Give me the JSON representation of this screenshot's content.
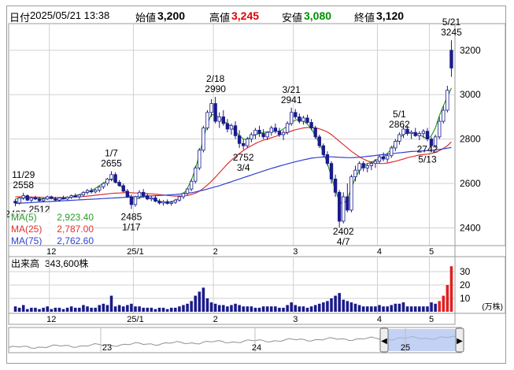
{
  "header": {
    "date_label": "日付",
    "date": "2025/05/21 13:38",
    "open_label": "始値",
    "open": "3,200",
    "high_label": "高値",
    "high": "3,245",
    "low_label": "安値",
    "low": "3,080",
    "close_label": "終値",
    "close": "3,120"
  },
  "colors": {
    "up": "#1a1a8c",
    "up_fill": "#ffffff",
    "down": "#1a1a8c",
    "ma5": "#2a9a2a",
    "ma25": "#e03030",
    "ma75": "#3040d0",
    "volume": "#1a1a8c",
    "volume_recent": "#e02020",
    "high_text": "#e00000",
    "low_text": "#009000",
    "grid": "#d0d0d0",
    "navigator_fill": "#a9bdf0"
  },
  "legend": [
    {
      "name": "MA(5)",
      "value": "2,923.40"
    },
    {
      "name": "MA(25)",
      "value": "2,787.00"
    },
    {
      "name": "MA(75)",
      "value": "2,762.60"
    }
  ],
  "volume_panel": {
    "label": "出来高",
    "value": "343,600株",
    "unit": "(万株)",
    "ticks": [
      "30",
      "20",
      "10"
    ]
  },
  "navigator": {
    "year_labels": [
      "23",
      "24",
      "25"
    ]
  },
  "chart_data": {
    "type": "candlestick",
    "price_axis": {
      "min": 2320,
      "max": 3320,
      "ticks": [
        2400,
        2600,
        2800,
        3000,
        3200
      ]
    },
    "x_axis_labels": [
      "12",
      "25/1",
      "2",
      "3",
      "4",
      "5"
    ],
    "annotations": [
      {
        "date": "11/29",
        "value": "2558"
      },
      {
        "date": "",
        "value": "2497"
      },
      {
        "date": "",
        "value": "2512"
      },
      {
        "date": "1/7",
        "value": "2655"
      },
      {
        "date": "1/17",
        "value": "2485"
      },
      {
        "date": "2/18",
        "value": "2990"
      },
      {
        "date": "3/4",
        "value": "2752"
      },
      {
        "date": "3/21",
        "value": "2941"
      },
      {
        "date": "4/7",
        "value": "2402"
      },
      {
        "date": "5/1",
        "value": "2862"
      },
      {
        "date": "5/13",
        "value": "2742"
      },
      {
        "date": "5/21",
        "value": "3245"
      }
    ],
    "candles": [
      [
        2520,
        2530,
        2497,
        2512
      ],
      [
        2512,
        2540,
        2505,
        2535
      ],
      [
        2535,
        2558,
        2525,
        2545
      ],
      [
        2545,
        2550,
        2520,
        2525
      ],
      [
        2525,
        2540,
        2515,
        2535
      ],
      [
        2535,
        2545,
        2525,
        2530
      ],
      [
        2530,
        2540,
        2518,
        2522
      ],
      [
        2522,
        2535,
        2515,
        2530
      ],
      [
        2530,
        2545,
        2525,
        2540
      ],
      [
        2540,
        2545,
        2528,
        2532
      ],
      [
        2532,
        2540,
        2520,
        2525
      ],
      [
        2525,
        2538,
        2518,
        2535
      ],
      [
        2535,
        2545,
        2528,
        2530
      ],
      [
        2530,
        2542,
        2522,
        2538
      ],
      [
        2538,
        2550,
        2530,
        2545
      ],
      [
        2545,
        2555,
        2535,
        2540
      ],
      [
        2540,
        2550,
        2530,
        2548
      ],
      [
        2548,
        2565,
        2540,
        2560
      ],
      [
        2560,
        2575,
        2550,
        2568
      ],
      [
        2568,
        2580,
        2555,
        2562
      ],
      [
        2562,
        2575,
        2555,
        2570
      ],
      [
        2570,
        2590,
        2560,
        2585
      ],
      [
        2585,
        2605,
        2575,
        2600
      ],
      [
        2600,
        2625,
        2590,
        2620
      ],
      [
        2620,
        2655,
        2610,
        2640
      ],
      [
        2640,
        2650,
        2600,
        2605
      ],
      [
        2605,
        2615,
        2585,
        2590
      ],
      [
        2590,
        2600,
        2560,
        2565
      ],
      [
        2565,
        2575,
        2535,
        2540
      ],
      [
        2540,
        2550,
        2485,
        2505
      ],
      [
        2505,
        2545,
        2495,
        2540
      ],
      [
        2540,
        2570,
        2530,
        2560
      ],
      [
        2560,
        2575,
        2535,
        2545
      ],
      [
        2545,
        2555,
        2525,
        2530
      ],
      [
        2530,
        2545,
        2520,
        2535
      ],
      [
        2535,
        2545,
        2515,
        2520
      ],
      [
        2520,
        2530,
        2505,
        2512
      ],
      [
        2512,
        2525,
        2500,
        2518
      ],
      [
        2518,
        2528,
        2505,
        2510
      ],
      [
        2510,
        2522,
        2500,
        2515
      ],
      [
        2515,
        2530,
        2508,
        2525
      ],
      [
        2525,
        2545,
        2518,
        2540
      ],
      [
        2540,
        2560,
        2530,
        2555
      ],
      [
        2555,
        2580,
        2545,
        2575
      ],
      [
        2575,
        2620,
        2565,
        2610
      ],
      [
        2610,
        2680,
        2600,
        2670
      ],
      [
        2670,
        2760,
        2660,
        2750
      ],
      [
        2750,
        2860,
        2740,
        2850
      ],
      [
        2850,
        2930,
        2840,
        2920
      ],
      [
        2920,
        2980,
        2900,
        2960
      ],
      [
        2960,
        2990,
        2870,
        2880
      ],
      [
        2880,
        2920,
        2850,
        2900
      ],
      [
        2900,
        2930,
        2860,
        2870
      ],
      [
        2870,
        2890,
        2830,
        2845
      ],
      [
        2845,
        2870,
        2820,
        2860
      ],
      [
        2860,
        2880,
        2800,
        2815
      ],
      [
        2815,
        2840,
        2760,
        2780
      ],
      [
        2780,
        2800,
        2752,
        2770
      ],
      [
        2770,
        2810,
        2760,
        2800
      ],
      [
        2800,
        2830,
        2785,
        2820
      ],
      [
        2820,
        2850,
        2800,
        2840
      ],
      [
        2840,
        2860,
        2810,
        2825
      ],
      [
        2825,
        2845,
        2800,
        2810
      ],
      [
        2810,
        2835,
        2795,
        2830
      ],
      [
        2830,
        2860,
        2815,
        2850
      ],
      [
        2850,
        2870,
        2825,
        2835
      ],
      [
        2835,
        2850,
        2810,
        2820
      ],
      [
        2820,
        2840,
        2795,
        2830
      ],
      [
        2830,
        2880,
        2820,
        2870
      ],
      [
        2870,
        2941,
        2860,
        2920
      ],
      [
        2920,
        2935,
        2890,
        2900
      ],
      [
        2900,
        2915,
        2870,
        2880
      ],
      [
        2880,
        2905,
        2865,
        2895
      ],
      [
        2895,
        2910,
        2870,
        2875
      ],
      [
        2875,
        2890,
        2840,
        2850
      ],
      [
        2850,
        2860,
        2800,
        2810
      ],
      [
        2810,
        2820,
        2760,
        2770
      ],
      [
        2770,
        2780,
        2720,
        2730
      ],
      [
        2730,
        2745,
        2680,
        2690
      ],
      [
        2690,
        2700,
        2600,
        2620
      ],
      [
        2620,
        2640,
        2540,
        2560
      ],
      [
        2560,
        2570,
        2402,
        2430
      ],
      [
        2430,
        2560,
        2420,
        2540
      ],
      [
        2540,
        2600,
        2470,
        2480
      ],
      [
        2480,
        2640,
        2470,
        2630
      ],
      [
        2630,
        2680,
        2610,
        2660
      ],
      [
        2660,
        2700,
        2640,
        2690
      ],
      [
        2690,
        2700,
        2655,
        2670
      ],
      [
        2670,
        2690,
        2650,
        2680
      ],
      [
        2680,
        2700,
        2660,
        2690
      ],
      [
        2690,
        2710,
        2670,
        2700
      ],
      [
        2700,
        2730,
        2690,
        2720
      ],
      [
        2720,
        2740,
        2700,
        2710
      ],
      [
        2710,
        2735,
        2695,
        2725
      ],
      [
        2725,
        2770,
        2715,
        2760
      ],
      [
        2760,
        2800,
        2745,
        2790
      ],
      [
        2790,
        2830,
        2775,
        2820
      ],
      [
        2820,
        2862,
        2805,
        2845
      ],
      [
        2845,
        2860,
        2815,
        2825
      ],
      [
        2825,
        2840,
        2800,
        2830
      ],
      [
        2830,
        2850,
        2810,
        2815
      ],
      [
        2815,
        2835,
        2795,
        2825
      ],
      [
        2825,
        2845,
        2805,
        2835
      ],
      [
        2835,
        2850,
        2790,
        2800
      ],
      [
        2800,
        2810,
        2742,
        2770
      ],
      [
        2770,
        2820,
        2760,
        2810
      ],
      [
        2810,
        2900,
        2800,
        2880
      ],
      [
        2880,
        2950,
        2870,
        2930
      ],
      [
        2930,
        3040,
        2920,
        3020
      ],
      [
        3200,
        3245,
        3080,
        3120
      ]
    ],
    "ma5": [
      2530,
      2532,
      2534,
      2536,
      2534,
      2533,
      2532,
      2531,
      2533,
      2533,
      2530,
      2528,
      2530,
      2535,
      2540,
      2545,
      2550,
      2556,
      2562,
      2568,
      2578,
      2590,
      2602,
      2612,
      2620,
      2610,
      2595,
      2575,
      2555,
      2535,
      2528,
      2535,
      2540,
      2538,
      2532,
      2526,
      2520,
      2515,
      2515,
      2518,
      2524,
      2535,
      2552,
      2578,
      2615,
      2665,
      2730,
      2800,
      2870,
      2910,
      2910,
      2895,
      2880,
      2870,
      2855,
      2835,
      2815,
      2800,
      2800,
      2810,
      2820,
      2825,
      2830,
      2832,
      2835,
      2835,
      2835,
      2845,
      2860,
      2875,
      2885,
      2890,
      2882,
      2868,
      2845,
      2815,
      2780,
      2740,
      2690,
      2630,
      2570,
      2520,
      2505,
      2530,
      2580,
      2625,
      2660,
      2680,
      2690,
      2695,
      2705,
      2712,
      2720,
      2735,
      2755,
      2780,
      2805,
      2820,
      2830,
      2830,
      2825,
      2820,
      2810,
      2800,
      2815,
      2850,
      2905,
      2950,
      2990,
      3030
    ],
    "ma25": [
      2540,
      2540,
      2540,
      2540,
      2539,
      2538,
      2538,
      2537,
      2537,
      2537,
      2537,
      2537,
      2537,
      2537,
      2538,
      2539,
      2540,
      2541,
      2543,
      2545,
      2547,
      2549,
      2551,
      2553,
      2555,
      2556,
      2557,
      2558,
      2559,
      2558,
      2557,
      2556,
      2555,
      2554,
      2553,
      2552,
      2550,
      2548,
      2546,
      2544,
      2543,
      2543,
      2544,
      2546,
      2550,
      2556,
      2565,
      2578,
      2593,
      2610,
      2628,
      2648,
      2668,
      2688,
      2705,
      2720,
      2735,
      2748,
      2760,
      2770,
      2780,
      2788,
      2795,
      2800,
      2806,
      2812,
      2818,
      2824,
      2830,
      2836,
      2842,
      2846,
      2850,
      2852,
      2852,
      2850,
      2846,
      2840,
      2832,
      2820,
      2805,
      2790,
      2775,
      2760,
      2745,
      2732,
      2720,
      2710,
      2702,
      2696,
      2692,
      2690,
      2690,
      2692,
      2696,
      2700,
      2705,
      2710,
      2716,
      2720,
      2724,
      2728,
      2730,
      2732,
      2735,
      2740,
      2748,
      2758,
      2770,
      2787
    ],
    "ma75": [
      2510,
      2511,
      2512,
      2513,
      2514,
      2515,
      2516,
      2517,
      2518,
      2519,
      2520,
      2521,
      2522,
      2523,
      2524,
      2525,
      2526,
      2527,
      2528,
      2529,
      2530,
      2531,
      2532,
      2533,
      2534,
      2535,
      2536,
      2537,
      2538,
      2539,
      2540,
      2541,
      2542,
      2543,
      2544,
      2545,
      2546,
      2547,
      2548,
      2549,
      2550,
      2552,
      2554,
      2556,
      2558,
      2562,
      2566,
      2570,
      2575,
      2580,
      2585,
      2590,
      2596,
      2602,
      2608,
      2614,
      2620,
      2626,
      2632,
      2638,
      2644,
      2650,
      2656,
      2662,
      2668,
      2673,
      2678,
      2683,
      2688,
      2693,
      2698,
      2702,
      2706,
      2710,
      2714,
      2716,
      2718,
      2719,
      2720,
      2720,
      2719,
      2718,
      2717,
      2716,
      2716,
      2717,
      2718,
      2720,
      2722,
      2724,
      2726,
      2728,
      2730,
      2732,
      2734,
      2736,
      2738,
      2740,
      2742,
      2744,
      2745,
      2746,
      2747,
      2748,
      2749,
      2751,
      2753,
      2756,
      2759,
      2762
    ],
    "volume": [
      4,
      3,
      5,
      2,
      3,
      3,
      2,
      3,
      4,
      2,
      3,
      3,
      2,
      3,
      4,
      3,
      3,
      5,
      4,
      3,
      3,
      5,
      6,
      5,
      12,
      4,
      5,
      4,
      5,
      6,
      4,
      4,
      3,
      3,
      3,
      2,
      3,
      3,
      2,
      3,
      3,
      4,
      5,
      6,
      8,
      12,
      15,
      18,
      10,
      7,
      6,
      5,
      5,
      4,
      5,
      6,
      5,
      4,
      4,
      4,
      3,
      3,
      4,
      4,
      4,
      4,
      3,
      3,
      5,
      7,
      5,
      4,
      4,
      3,
      4,
      5,
      6,
      7,
      8,
      10,
      12,
      14,
      9,
      8,
      7,
      6,
      5,
      4,
      4,
      4,
      4,
      5,
      4,
      4,
      5,
      6,
      6,
      7,
      4,
      4,
      4,
      4,
      4,
      4,
      7,
      6,
      8,
      12,
      20,
      34
    ],
    "volume_unit": "万株"
  }
}
